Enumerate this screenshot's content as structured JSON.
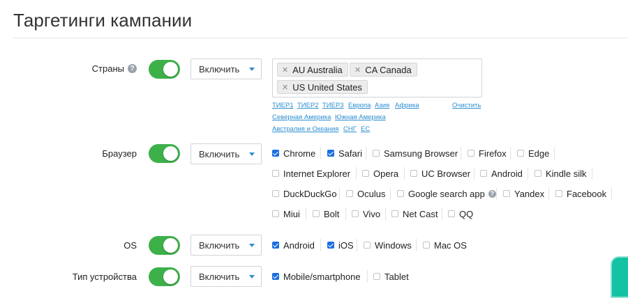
{
  "page": {
    "title": "Таргетинги кампании"
  },
  "colors": {
    "toggle_on": "#3db04a",
    "link": "#2b8ed0",
    "checkbox_checked": "#1a6fe0",
    "accent_widget": "#13c3a3"
  },
  "rows": {
    "countries": {
      "label": "Страны",
      "help_icon": "question-icon",
      "toggle_on": true,
      "mode": "Включить",
      "tags": [
        "AU Australia",
        "CA Canada",
        "US United States"
      ],
      "quick_links": [
        "ТИЕР1",
        "ТИЕР2",
        "ТИЕР3",
        "Европа",
        "Азия",
        "Африка",
        "Северная Америка",
        "Южная Америка",
        "Австралия и Океания",
        "СНГ",
        "ЕС"
      ],
      "clear_label": "Очистить"
    },
    "browser": {
      "label": "Браузер",
      "toggle_on": true,
      "mode": "Включить",
      "options": [
        {
          "label": "Chrome",
          "checked": true
        },
        {
          "label": "Safari",
          "checked": true
        },
        {
          "label": "Samsung Browser",
          "checked": false
        },
        {
          "label": "Firefox",
          "checked": false
        },
        {
          "label": "Edge",
          "checked": false
        },
        {
          "label": "Internet Explorer",
          "checked": false
        },
        {
          "label": "Opera",
          "checked": false
        },
        {
          "label": "UC Browser",
          "checked": false
        },
        {
          "label": "Android",
          "checked": false
        },
        {
          "label": "Kindle silk",
          "checked": false
        },
        {
          "label": "DuckDuckGo",
          "checked": false
        },
        {
          "label": "Oculus",
          "checked": false
        },
        {
          "label": "Google search app",
          "checked": false,
          "help_icon": "question-icon"
        },
        {
          "label": "Yandex",
          "checked": false
        },
        {
          "label": "Facebook",
          "checked": false
        },
        {
          "label": "Miui",
          "checked": false
        },
        {
          "label": "Bolt",
          "checked": false
        },
        {
          "label": "Vivo",
          "checked": false
        },
        {
          "label": "Net Cast",
          "checked": false
        },
        {
          "label": "QQ",
          "checked": false
        }
      ]
    },
    "os": {
      "label": "OS",
      "toggle_on": true,
      "mode": "Включить",
      "options": [
        {
          "label": "Android",
          "checked": true
        },
        {
          "label": "iOS",
          "checked": true
        },
        {
          "label": "Windows",
          "checked": false
        },
        {
          "label": "Mac OS",
          "checked": false
        }
      ]
    },
    "device": {
      "label": "Тип устройства",
      "toggle_on": true,
      "mode": "Включить",
      "options": [
        {
          "label": "Mobile/smartphone",
          "checked": true
        },
        {
          "label": "Tablet",
          "checked": false
        }
      ]
    }
  }
}
